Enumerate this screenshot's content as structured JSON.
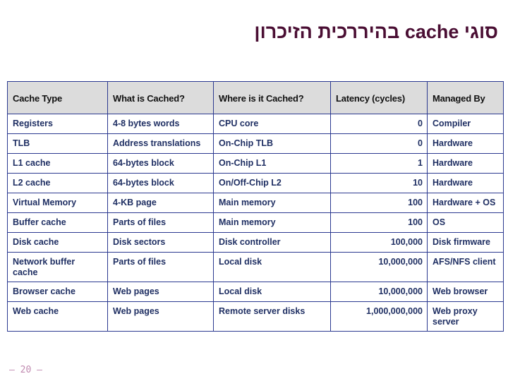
{
  "slide": {
    "title": "סוגי cache בהיררכית הזיכרון",
    "title_color": "#4a0e33",
    "page_marker": "– 20 –",
    "page_marker_color": "#c08ab0",
    "background_color": "#ffffff"
  },
  "table": {
    "header_background": "#dcdcdc",
    "border_color": "#2b3990",
    "body_text_color": "#1f2f63",
    "columns": [
      {
        "key": "cache_type",
        "label": "Cache Type",
        "align": "left"
      },
      {
        "key": "what_cached",
        "label": "What is Cached?",
        "align": "left"
      },
      {
        "key": "where_cached",
        "label": "Where is it Cached?",
        "align": "left"
      },
      {
        "key": "latency",
        "label": "Latency (cycles)",
        "align": "right"
      },
      {
        "key": "managed_by",
        "label": "Managed By",
        "align": "left"
      }
    ],
    "rows": [
      {
        "cache_type": "Registers",
        "what_cached": "4-8 bytes words",
        "where_cached": " CPU core",
        "latency": "0",
        "managed_by": "Compiler",
        "height": "med"
      },
      {
        "cache_type": "TLB",
        "what_cached": "Address translations",
        "where_cached": "On-Chip TLB",
        "latency": "0",
        "managed_by": "Hardware",
        "height": "tall"
      },
      {
        "cache_type": "L1 cache",
        "what_cached": "64-bytes block",
        "where_cached": "On-Chip L1",
        "latency": "1",
        "managed_by": "Hardware",
        "height": "normal"
      },
      {
        "cache_type": "L2 cache",
        "what_cached": "64-bytes block",
        "where_cached": "On/Off-Chip L2",
        "latency": "10",
        "managed_by": "Hardware",
        "height": "normal"
      },
      {
        "cache_type": "Virtual Memory",
        "what_cached": "4-KB page",
        "where_cached": "Main memory",
        "latency": "100",
        "managed_by": "Hardware + OS",
        "height": "normal"
      },
      {
        "cache_type": "Buffer cache",
        "what_cached": "Parts of files",
        "where_cached": "Main memory",
        "latency": "100",
        "managed_by": "OS",
        "height": "normal"
      },
      {
        "cache_type": "Disk cache",
        "what_cached": "Disk sectors",
        "where_cached": "Disk controller",
        "latency": "100,000",
        "managed_by": "Disk firmware",
        "height": "normal"
      },
      {
        "cache_type": "Network buffer cache",
        "what_cached": "Parts of files",
        "where_cached": "Local disk",
        "latency": "10,000,000",
        "managed_by": "AFS/NFS client",
        "height": "tall"
      },
      {
        "cache_type": "Browser cache",
        "what_cached": "Web pages",
        "where_cached": "Local disk",
        "latency": "10,000,000",
        "managed_by": "Web browser",
        "height": "tall"
      },
      {
        "cache_type": "Web cache",
        "what_cached": "Web pages",
        "where_cached": "Remote server disks",
        "latency": "1,000,000,000",
        "managed_by": "Web proxy server",
        "height": "taller"
      }
    ]
  }
}
